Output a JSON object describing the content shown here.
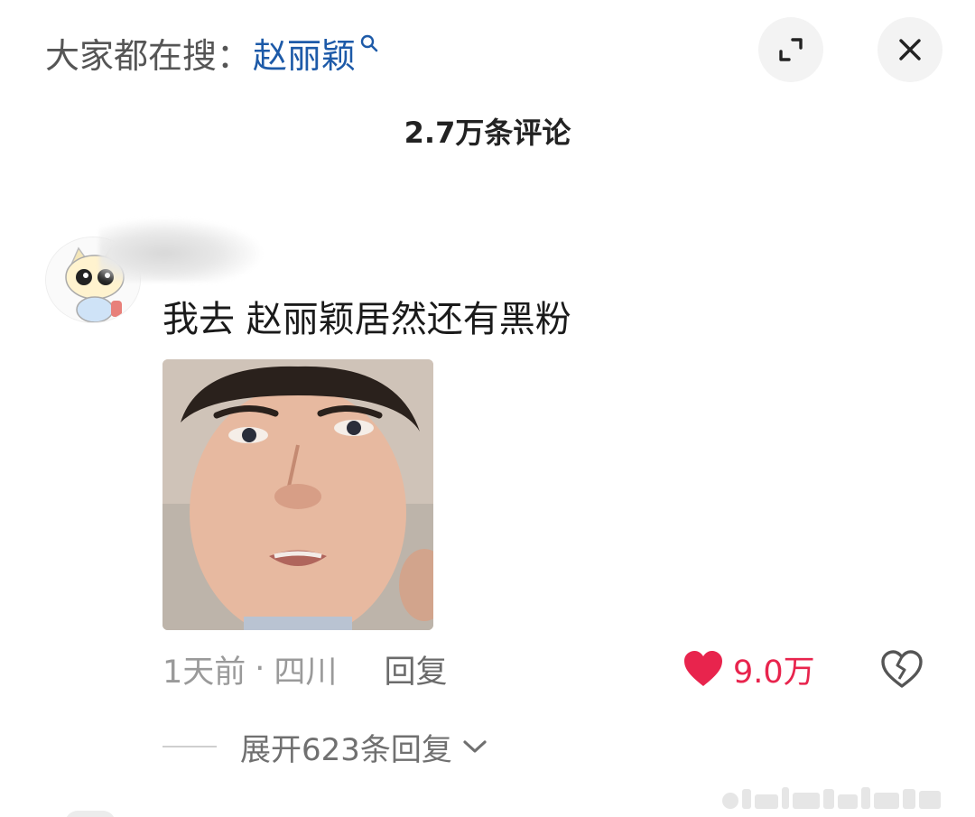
{
  "header": {
    "search_prefix": "大家都在搜：",
    "search_keyword": "赵丽颖",
    "expand_icon": "expand-icon",
    "close_icon": "close-icon"
  },
  "comments_count_label": "2.7万条评论",
  "comment": {
    "text": "我去 赵丽颖居然还有黑粉",
    "time": "1天前",
    "separator": "·",
    "location": "四川",
    "reply_label": "回复",
    "like_count": "9.0万",
    "like_icon": "heart-filled-icon",
    "dislike_icon": "broken-heart-icon",
    "expand_replies_label": "展开623条回复"
  },
  "colors": {
    "keyword": "#1d5aa8",
    "like": "#e8244d",
    "muted": "#9a9a9a"
  }
}
